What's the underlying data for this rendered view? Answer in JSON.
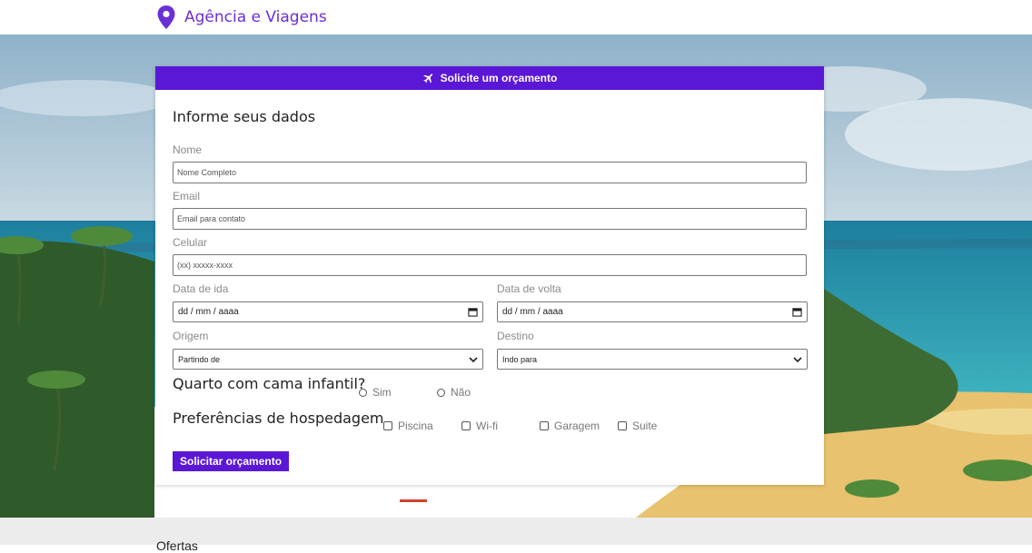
{
  "header": {
    "brand": "Agência e Viagens",
    "icon": "map-pin-icon",
    "accent": "#6a2fd6"
  },
  "form": {
    "banner": "Solicite um orçamento",
    "banner_icon": "airplane-icon",
    "banner_color": "#5b17d6",
    "title": "Informe seus dados",
    "nome": {
      "label": "Nome",
      "placeholder": "Nome Completo"
    },
    "email": {
      "label": "Email",
      "placeholder": "Email para contato"
    },
    "celular": {
      "label": "Celular",
      "placeholder": "(xx) xxxxx-xxxx"
    },
    "data_ida": {
      "label": "Data de ida",
      "value": "dd / mm / aaaa"
    },
    "data_volta": {
      "label": "Data de volta",
      "value": "dd / mm / aaaa"
    },
    "origem": {
      "label": "Origem",
      "value": "Partindo de"
    },
    "destino": {
      "label": "Destino",
      "value": "Indo para"
    },
    "quarto": {
      "title": "Quarto com cama infantil?",
      "options": [
        "Sim",
        "Não"
      ]
    },
    "preferencias": {
      "title": "Preferências de hospedagem",
      "options": [
        "Piscina",
        "Wi-fi",
        "Garagem",
        "Suite"
      ]
    },
    "submit": "Solicitar orçamento"
  },
  "footer": {
    "section_title": "Ofertas"
  }
}
